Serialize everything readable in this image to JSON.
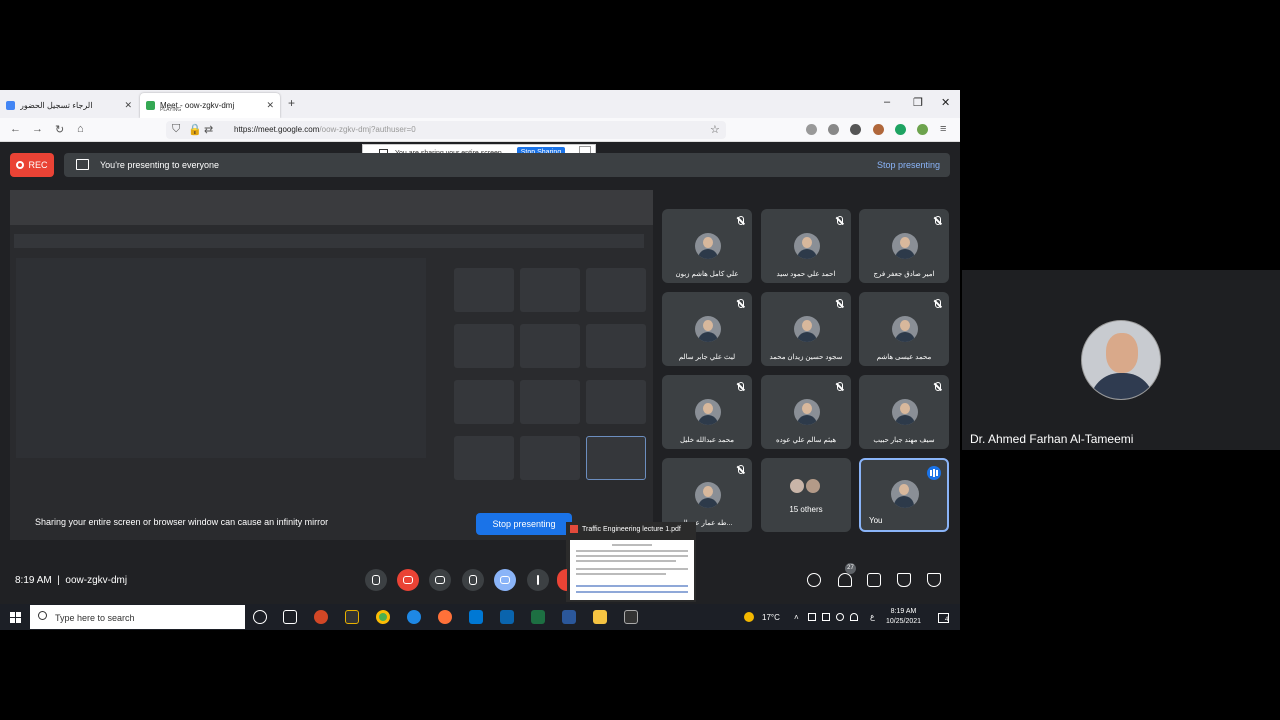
{
  "browser": {
    "tabs": [
      {
        "title": "الرجاء تسجيل الحضور",
        "active": false,
        "favicon_color": "#4285f4"
      },
      {
        "title": "Meet - oow-zgkv-dmj",
        "subtitle": "PLAYING",
        "active": true,
        "favicon_color": "#34a853"
      }
    ],
    "new_tab": "+",
    "url_host": "https://meet.google.com",
    "url_path": "/oow-zgkv-dmj?authuser=0"
  },
  "share_bar": {
    "text": "You are sharing your entire screen.",
    "stop_label": "Stop Sharing",
    "minimize": "_"
  },
  "meet": {
    "rec_label": "REC",
    "presenting_text": "You're presenting to everyone",
    "stop_presenting_link": "Stop presenting",
    "warning": "Sharing your entire screen or browser window can cause an infinity mirror",
    "stop_presenting_button": "Stop presenting",
    "time": "8:19 AM",
    "meeting_code": "oow-zgkv-dmj",
    "participants_count": "27",
    "tiles": [
      {
        "name": "علي كامل هاشم زبون",
        "muted": true
      },
      {
        "name": "احمد علي حمود سيد",
        "muted": true
      },
      {
        "name": "امير صادق جعفر فرج",
        "muted": true
      },
      {
        "name": "ليث علي جابر سالم",
        "muted": true
      },
      {
        "name": "سجود حسين زيدان محمد",
        "muted": true
      },
      {
        "name": "محمد عيسى هاشم",
        "muted": true
      },
      {
        "name": "محمد عبدالله خليل",
        "muted": true
      },
      {
        "name": "هيثم سالم علي عوده",
        "muted": true
      },
      {
        "name": "سيف مهند جبار حبيب",
        "muted": true
      },
      {
        "name": "طه عمار عبد الـ...",
        "muted": true
      }
    ],
    "others_label": "15 others",
    "you_label": "You"
  },
  "preview": {
    "title": "Traffic Engineering lecture 1.pdf"
  },
  "taskbar": {
    "search_placeholder": "Type here to search",
    "temperature": "17°C",
    "lang": "ع",
    "clock_time": "8:19 AM",
    "clock_date": "10/25/2021",
    "notif_count": "4"
  },
  "speaker": {
    "name": "Dr. Ahmed Farhan Al-Tameemi"
  },
  "colors": {
    "accent": "#1a73e8",
    "record": "#ea4335",
    "link": "#8ab4f8",
    "tile_bg": "#3c4043"
  }
}
